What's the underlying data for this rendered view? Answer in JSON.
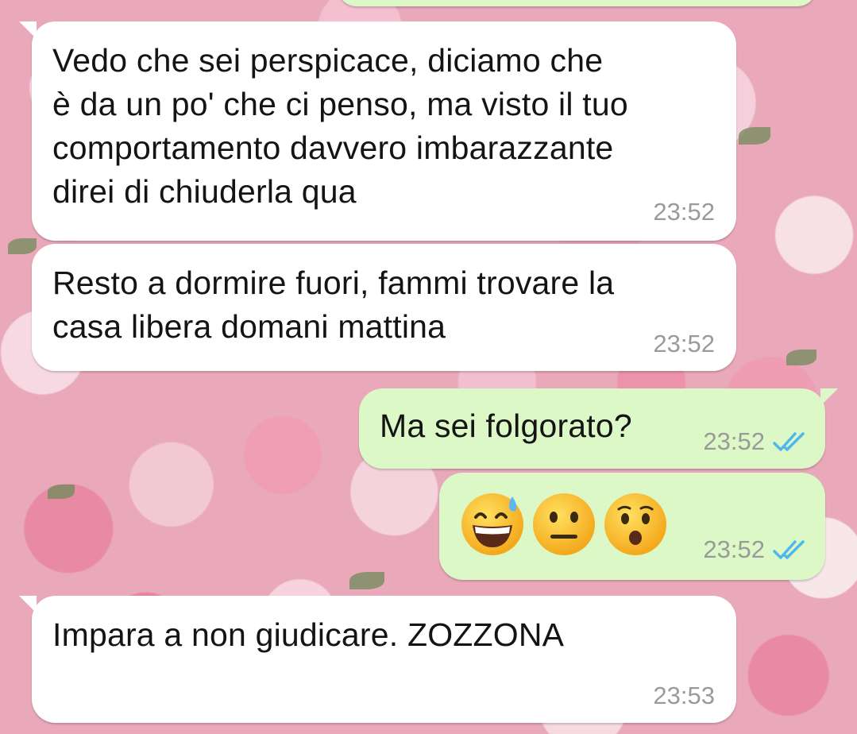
{
  "chat": {
    "messages": [
      {
        "direction": "outgoing",
        "text": "",
        "time": ""
      },
      {
        "direction": "incoming",
        "text": "Vedo che sei perspicace, diciamo che\nè da un po' che ci penso, ma visto il tuo\ncomportamento davvero imbarazzante\ndirei di chiuderla qua",
        "time": "23:52"
      },
      {
        "direction": "incoming",
        "text": "Resto a dormire fuori, fammi trovare la\ncasa libera domani mattina",
        "time": "23:52"
      },
      {
        "direction": "outgoing",
        "text": "Ma sei folgorato?",
        "time": "23:52",
        "status": "read"
      },
      {
        "direction": "outgoing",
        "emojis": [
          "grinning-face-with-sweat",
          "neutral-face",
          "hushed-face"
        ],
        "time": "23:52",
        "status": "read"
      },
      {
        "direction": "incoming",
        "text": "Impara a non giudicare. ZOZZONA",
        "time": "23:53"
      }
    ]
  },
  "colors": {
    "incoming_bubble": "#ffffff",
    "outgoing_bubble": "#dcf8c6",
    "read_ticks": "#4fb6ec",
    "timestamp": "#9a9a9a"
  },
  "icons": {
    "read_receipt": "double-check-icon"
  }
}
